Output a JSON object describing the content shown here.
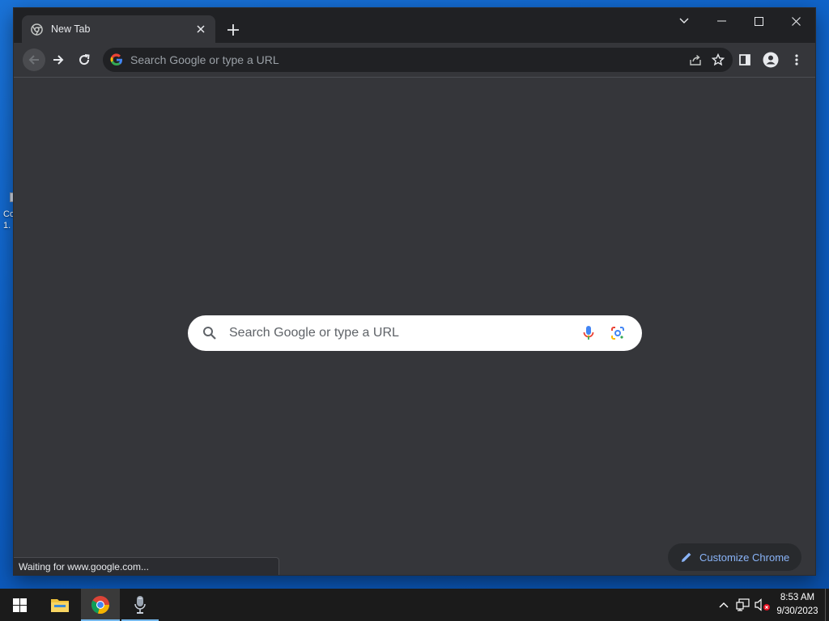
{
  "desktop": {
    "icon_label": "Co\n1."
  },
  "tab": {
    "title": "New Tab"
  },
  "toolbar": {
    "omnibox_placeholder": "Search Google or type a URL"
  },
  "ntp": {
    "search_placeholder": "Search Google or type a URL",
    "customize_label": "Customize Chrome"
  },
  "status": {
    "text": "Waiting for www.google.com..."
  },
  "taskbar": {
    "items": [
      {
        "name": "start-button",
        "icon": "windows-logo"
      },
      {
        "name": "file-explorer",
        "icon": "folder-icon"
      },
      {
        "name": "chrome",
        "icon": "chrome-icon",
        "active": true
      },
      {
        "name": "voice-recorder",
        "icon": "microphone-icon"
      }
    ],
    "time": "8:53 AM",
    "date": "9/30/2023"
  },
  "colors": {
    "frame": "#202124",
    "toolbar": "#35363a",
    "accent": "#8ab4f8",
    "desktop": "#0f63c9"
  }
}
